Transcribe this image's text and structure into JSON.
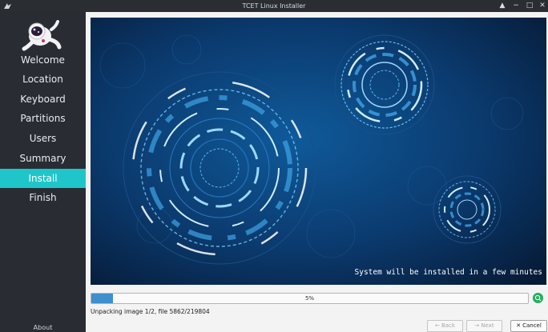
{
  "window": {
    "title": "TCET Linux Installer",
    "icons": [
      "installer-app-icon",
      "keep-above-icon",
      "minimize-icon",
      "maximize-icon",
      "close-icon"
    ]
  },
  "sidebar": {
    "items": [
      {
        "label": "Welcome"
      },
      {
        "label": "Location"
      },
      {
        "label": "Keyboard"
      },
      {
        "label": "Partitions"
      },
      {
        "label": "Users"
      },
      {
        "label": "Summary"
      },
      {
        "label": "Install",
        "active": true
      },
      {
        "label": "Finish"
      }
    ],
    "about_label": "About",
    "active_color": "#1fc6c9"
  },
  "slideshow": {
    "caption": "System will be installed in a few minutes"
  },
  "progress": {
    "value": 0.05,
    "label": "5%",
    "status": "Unpacking image 1/2, file 5862/219804"
  },
  "buttons": {
    "back_label": "Back",
    "next_label": "Next",
    "cancel_label": "Cancel"
  }
}
